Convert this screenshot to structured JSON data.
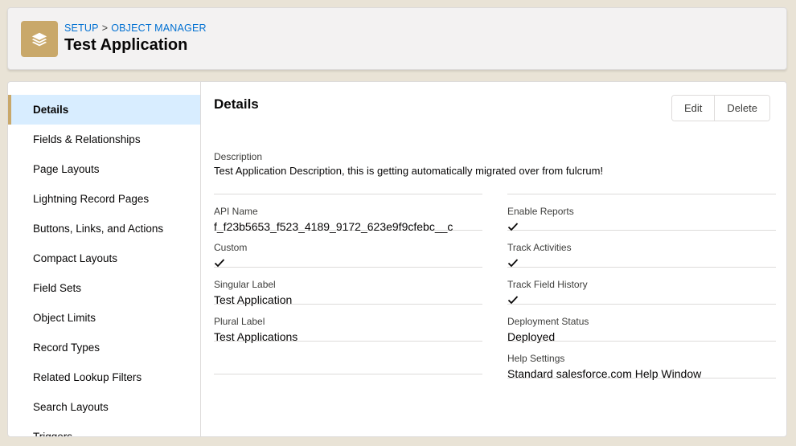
{
  "header": {
    "breadcrumb": [
      "SETUP",
      "OBJECT MANAGER"
    ],
    "breadcrumb_separator": ">",
    "title": "Test Application",
    "icon": "layers-icon",
    "icon_color": "#c9a86a"
  },
  "sidebar": {
    "items": [
      {
        "label": "Details",
        "active": true
      },
      {
        "label": "Fields & Relationships"
      },
      {
        "label": "Page Layouts"
      },
      {
        "label": "Lightning Record Pages"
      },
      {
        "label": "Buttons, Links, and Actions"
      },
      {
        "label": "Compact Layouts"
      },
      {
        "label": "Field Sets"
      },
      {
        "label": "Object Limits"
      },
      {
        "label": "Record Types"
      },
      {
        "label": "Related Lookup Filters"
      },
      {
        "label": "Search Layouts"
      },
      {
        "label": "Triggers"
      }
    ],
    "active_color": "#d8edff"
  },
  "main": {
    "title": "Details",
    "buttons": {
      "edit": "Edit",
      "delete": "Delete"
    },
    "description": {
      "label": "Description",
      "value": "Test Application Description, this is getting automatically migrated over from fulcrum!"
    },
    "left_fields": [
      {
        "label": "API Name",
        "value": "f_f23b5653_f523_4189_9172_623e9f9cfebc__c"
      },
      {
        "label": "Custom",
        "checked": true
      },
      {
        "label": "Singular Label",
        "value": "Test Application"
      },
      {
        "label": "Plural Label",
        "value": "Test Applications"
      }
    ],
    "right_fields": [
      {
        "label": "Enable Reports",
        "checked": true
      },
      {
        "label": "Track Activities",
        "checked": true
      },
      {
        "label": "Track Field History",
        "checked": true
      },
      {
        "label": "Deployment Status",
        "value": "Deployed"
      },
      {
        "label": "Help Settings",
        "value": "Standard salesforce.com Help Window"
      }
    ]
  }
}
